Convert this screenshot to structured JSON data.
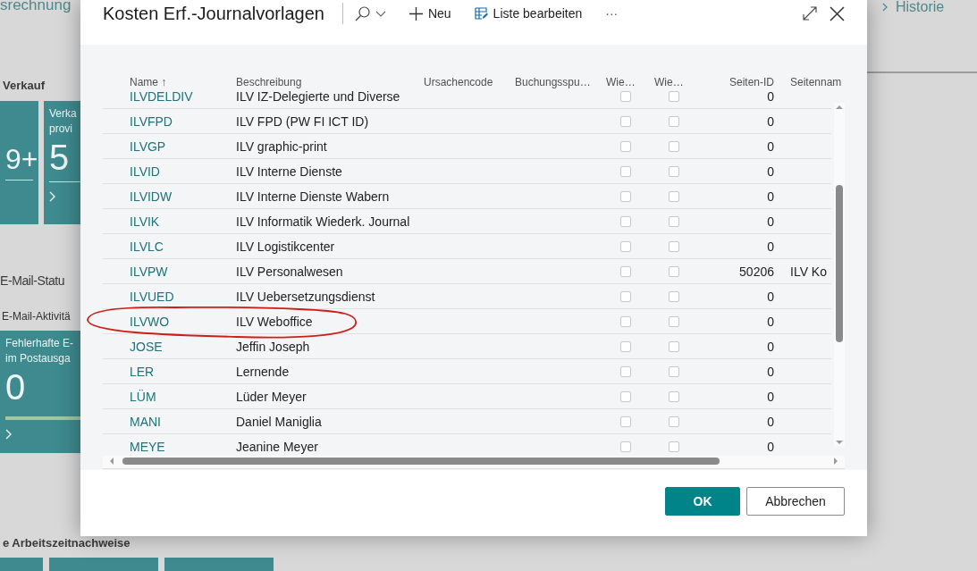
{
  "background": {
    "top_text": "srechnung",
    "sales_heading": "Verkauf",
    "sales_tiles": [
      {
        "value": "9+",
        "chevron": false
      },
      {
        "caption": [
          "Verka",
          "provi"
        ],
        "value": "5",
        "chevron": true
      }
    ],
    "email_heading": "E-Mail-Statu",
    "email_subheading": "E-Mail-Aktivitä",
    "email_tile": {
      "caption": [
        "Fehlerhafte E-",
        "im Postausga"
      ],
      "value": "0",
      "chevron": true
    },
    "timesheet_heading": "e Arbeitszeitnachweise",
    "history_link": "Historie"
  },
  "dialog": {
    "title": "Kosten Erf.-Journalvorlagen",
    "actions": [
      {
        "kind": "search"
      },
      {
        "kind": "new",
        "label": "Neu"
      },
      {
        "kind": "edit_list",
        "label": "Liste bearbeiten"
      },
      {
        "kind": "more",
        "label": "···"
      }
    ],
    "columns": [
      {
        "label": "Name",
        "sort": "↑"
      },
      {
        "label": "Beschreibung"
      },
      {
        "label": "Ursachencode"
      },
      {
        "label": "Buchungsspu…"
      },
      {
        "label": "Wie…"
      },
      {
        "label": "Wie…"
      },
      {
        "label": "Seiten-ID"
      },
      {
        "label": "Seitennam"
      }
    ],
    "rows": [
      {
        "name": "ILVDELDIV",
        "description": "ILV IZ-Delegierte und Diverse",
        "check_1": false,
        "check_2": false,
        "page_id": "0",
        "circled": false
      },
      {
        "name": "ILVFPD",
        "description": "ILV FPD (PW FI ICT ID)",
        "check_1": false,
        "check_2": false,
        "page_id": "0",
        "circled": false
      },
      {
        "name": "ILVGP",
        "description": "ILV graphic-print",
        "check_1": false,
        "check_2": false,
        "page_id": "0",
        "circled": false
      },
      {
        "name": "ILVID",
        "description": "ILV Interne Dienste",
        "check_1": false,
        "check_2": false,
        "page_id": "0",
        "circled": false
      },
      {
        "name": "ILVIDW",
        "description": "ILV Interne Dienste Wabern",
        "check_1": false,
        "check_2": false,
        "page_id": "0",
        "circled": false
      },
      {
        "name": "ILVIK",
        "description": "ILV Informatik Wiederk. Journal",
        "check_1": false,
        "check_2": false,
        "page_id": "0",
        "circled": false
      },
      {
        "name": "ILVLC",
        "description": "ILV Logistikcenter",
        "check_1": false,
        "check_2": false,
        "page_id": "0",
        "circled": false
      },
      {
        "name": "ILVPW",
        "description": "ILV Personalwesen",
        "check_1": false,
        "check_2": false,
        "page_id": "50206",
        "page_name": "ILV Ko",
        "circled": false
      },
      {
        "name": "ILVUED",
        "description": "ILV Uebersetzungsdienst",
        "check_1": false,
        "check_2": false,
        "page_id": "0",
        "circled": false
      },
      {
        "name": "ILVWO",
        "description": "ILV Weboffice",
        "check_1": false,
        "check_2": false,
        "page_id": "0",
        "circled": true
      },
      {
        "name": "JOSE",
        "description": "Jeffin Joseph",
        "check_1": false,
        "check_2": false,
        "page_id": "0",
        "circled": false
      },
      {
        "name": "LER",
        "description": "Lernende",
        "check_1": false,
        "check_2": false,
        "page_id": "0",
        "circled": false
      },
      {
        "name": "LÜM",
        "description": "Lüder Meyer",
        "check_1": false,
        "check_2": false,
        "page_id": "0",
        "circled": false
      },
      {
        "name": "MANI",
        "description": "Daniel Maniglia",
        "check_1": false,
        "check_2": false,
        "page_id": "0",
        "circled": false
      },
      {
        "name": "MEYE",
        "description": "Jeanine Meyer",
        "check_1": false,
        "check_2": false,
        "page_id": "0",
        "circled": false
      }
    ],
    "buttons": [
      {
        "label": "OK",
        "kind": "primary"
      },
      {
        "label": "Abbrechen",
        "kind": "secondary"
      }
    ]
  }
}
